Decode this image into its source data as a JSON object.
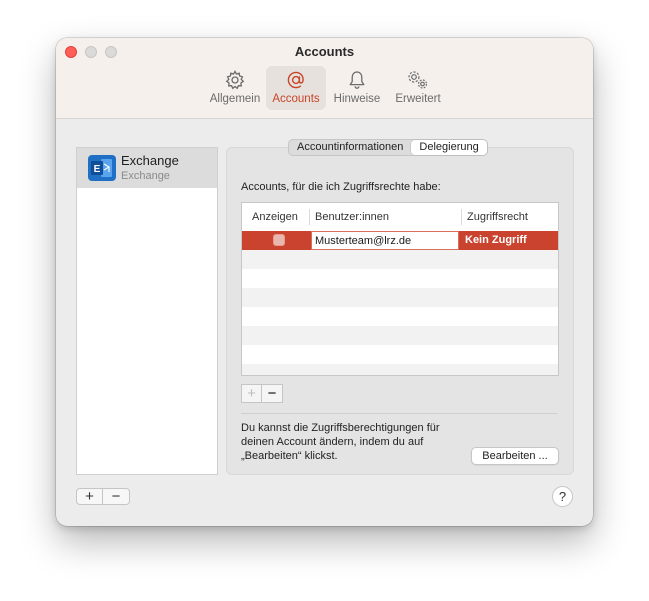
{
  "window": {
    "title": "Accounts"
  },
  "toolbar": {
    "items": [
      {
        "label": "Allgemein",
        "icon": "gear-icon",
        "active": false
      },
      {
        "label": "Accounts",
        "icon": "at-icon",
        "active": true
      },
      {
        "label": "Hinweise",
        "icon": "bell-icon",
        "active": false
      },
      {
        "label": "Erweitert",
        "icon": "gears-icon",
        "active": false
      }
    ]
  },
  "sidebar": {
    "accounts": [
      {
        "name": "Exchange",
        "type": "Exchange",
        "icon": "exchange-icon"
      }
    ]
  },
  "tabs": [
    {
      "label": "Accountinformationen",
      "active": false
    },
    {
      "label": "Delegierung",
      "active": true
    }
  ],
  "delegation": {
    "heading": "Accounts, für die ich Zugriffsrechte habe:",
    "columns": [
      "Anzeigen",
      "Benutzer:innen",
      "Zugriffsrecht"
    ],
    "rows": [
      {
        "show": false,
        "user": "Musterteam@lrz.de",
        "access": "Kein Zugriff",
        "selected": true
      }
    ],
    "add_label": "+",
    "remove_label": "−",
    "help_lines": [
      "Du kannst die Zugriffsberechtigungen für",
      "deinen Account ändern, indem du auf",
      "„Bearbeiten“ klickst."
    ],
    "edit_button": "Bearbeiten ..."
  },
  "footer": {
    "add_label": "+",
    "remove_label": "−",
    "help_label": "?"
  },
  "colors": {
    "accent": "#c8452a",
    "selection": "#c9432e",
    "close": "#fe5f57",
    "exchange_blue": "#1f6fc5"
  }
}
